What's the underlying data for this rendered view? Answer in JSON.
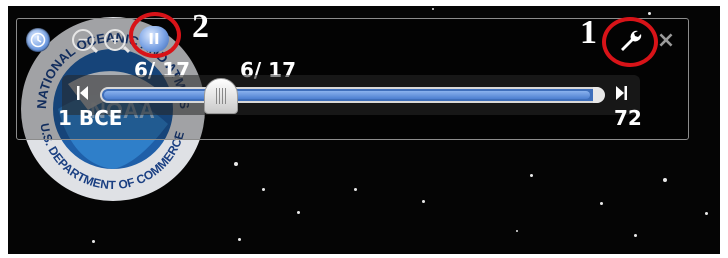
{
  "toolbar": {
    "sync_icon": "clock-icon",
    "zoom_out_glyph": "−",
    "zoom_in_glyph": "+",
    "play_glyph": "II",
    "wrench_glyph": "🔧",
    "close_glyph": "×"
  },
  "callouts": [
    {
      "number": "2",
      "target": "play-pause"
    },
    {
      "number": "1",
      "target": "settings"
    }
  ],
  "timeline": {
    "current_date_left": "6/ 17",
    "current_date_right": "6/ 17",
    "start_label": "1 BCE",
    "end_label": "72",
    "position_fraction": 0.24
  },
  "colors": {
    "callout_ring": "#d81318",
    "slider_blue": "#3f6fbb"
  },
  "seal_text": {
    "top": "NATIONAL OCEANIC AND ATMOSPHERIC",
    "center": "NOAA",
    "bottom": "U.S. DEPARTMENT OF COMMERCE"
  }
}
